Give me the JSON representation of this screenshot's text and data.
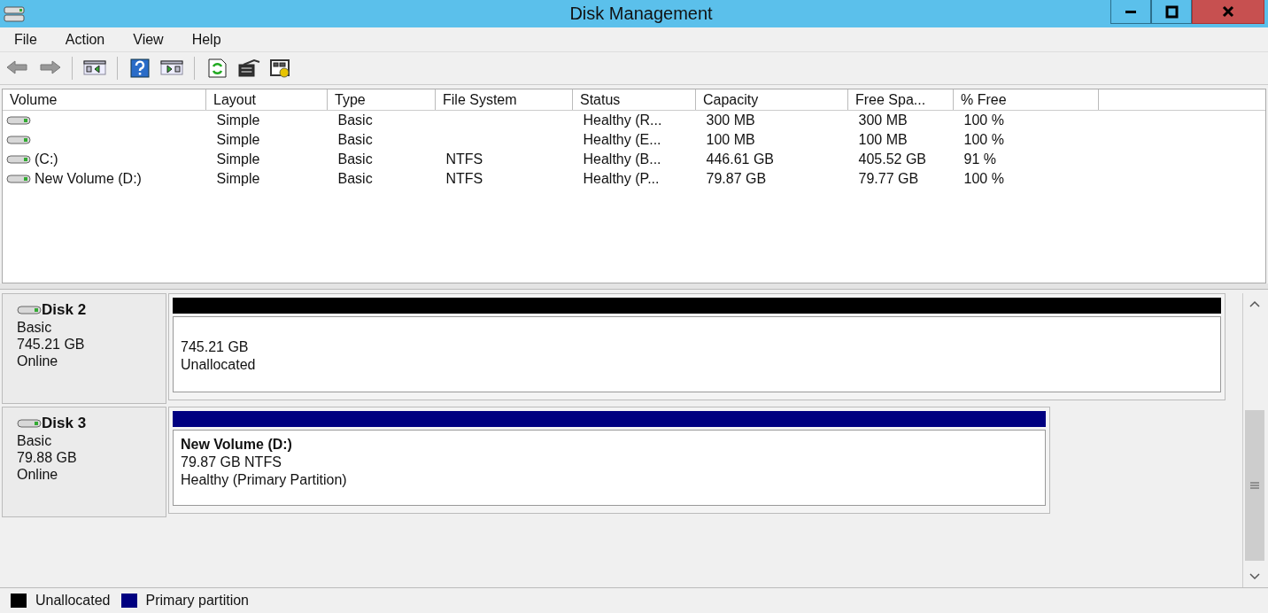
{
  "window": {
    "title": "Disk Management"
  },
  "menu": [
    "File",
    "Action",
    "View",
    "Help"
  ],
  "toolbar": [
    {
      "kind": "back",
      "disabled": true
    },
    {
      "kind": "forward",
      "disabled": true
    },
    {
      "kind": "sep"
    },
    {
      "kind": "hide-tree"
    },
    {
      "kind": "sep"
    },
    {
      "kind": "help"
    },
    {
      "kind": "show-pane"
    },
    {
      "kind": "sep"
    },
    {
      "kind": "refresh"
    },
    {
      "kind": "properties"
    },
    {
      "kind": "settings"
    }
  ],
  "volume_table": {
    "columns": [
      "Volume",
      "Layout",
      "Type",
      "File System",
      "Status",
      "Capacity",
      "Free Spa...",
      "% Free"
    ],
    "rows": [
      [
        "",
        "Simple",
        "Basic",
        "",
        "Healthy (R...",
        "300 MB",
        "300 MB",
        "100 %"
      ],
      [
        "",
        "Simple",
        "Basic",
        "",
        "Healthy (E...",
        "100 MB",
        "100 MB",
        "100 %"
      ],
      [
        "(C:)",
        "Simple",
        "Basic",
        "NTFS",
        "Healthy (B...",
        "446.61 GB",
        "405.52 GB",
        "91 %"
      ],
      [
        "New Volume (D:)",
        "Simple",
        "Basic",
        "NTFS",
        "Healthy (P...",
        "79.87 GB",
        "79.77 GB",
        "100 %"
      ]
    ]
  },
  "disks": [
    {
      "name": "Disk 2",
      "type": "Basic",
      "size": "745.21 GB",
      "state": "Online",
      "partitions": [
        {
          "kind": "unallocated",
          "lines": [
            "745.21 GB",
            "Unallocated"
          ]
        }
      ]
    },
    {
      "name": "Disk 3",
      "type": "Basic",
      "size": "79.88 GB",
      "state": "Online",
      "partitions": [
        {
          "kind": "primary",
          "title": "New Volume  (D:)",
          "lines": [
            "79.87 GB NTFS",
            "Healthy (Primary Partition)"
          ]
        }
      ]
    }
  ],
  "legend": [
    {
      "label": "Unallocated",
      "color": "#000000"
    },
    {
      "label": "Primary partition",
      "color": "#000080"
    }
  ]
}
